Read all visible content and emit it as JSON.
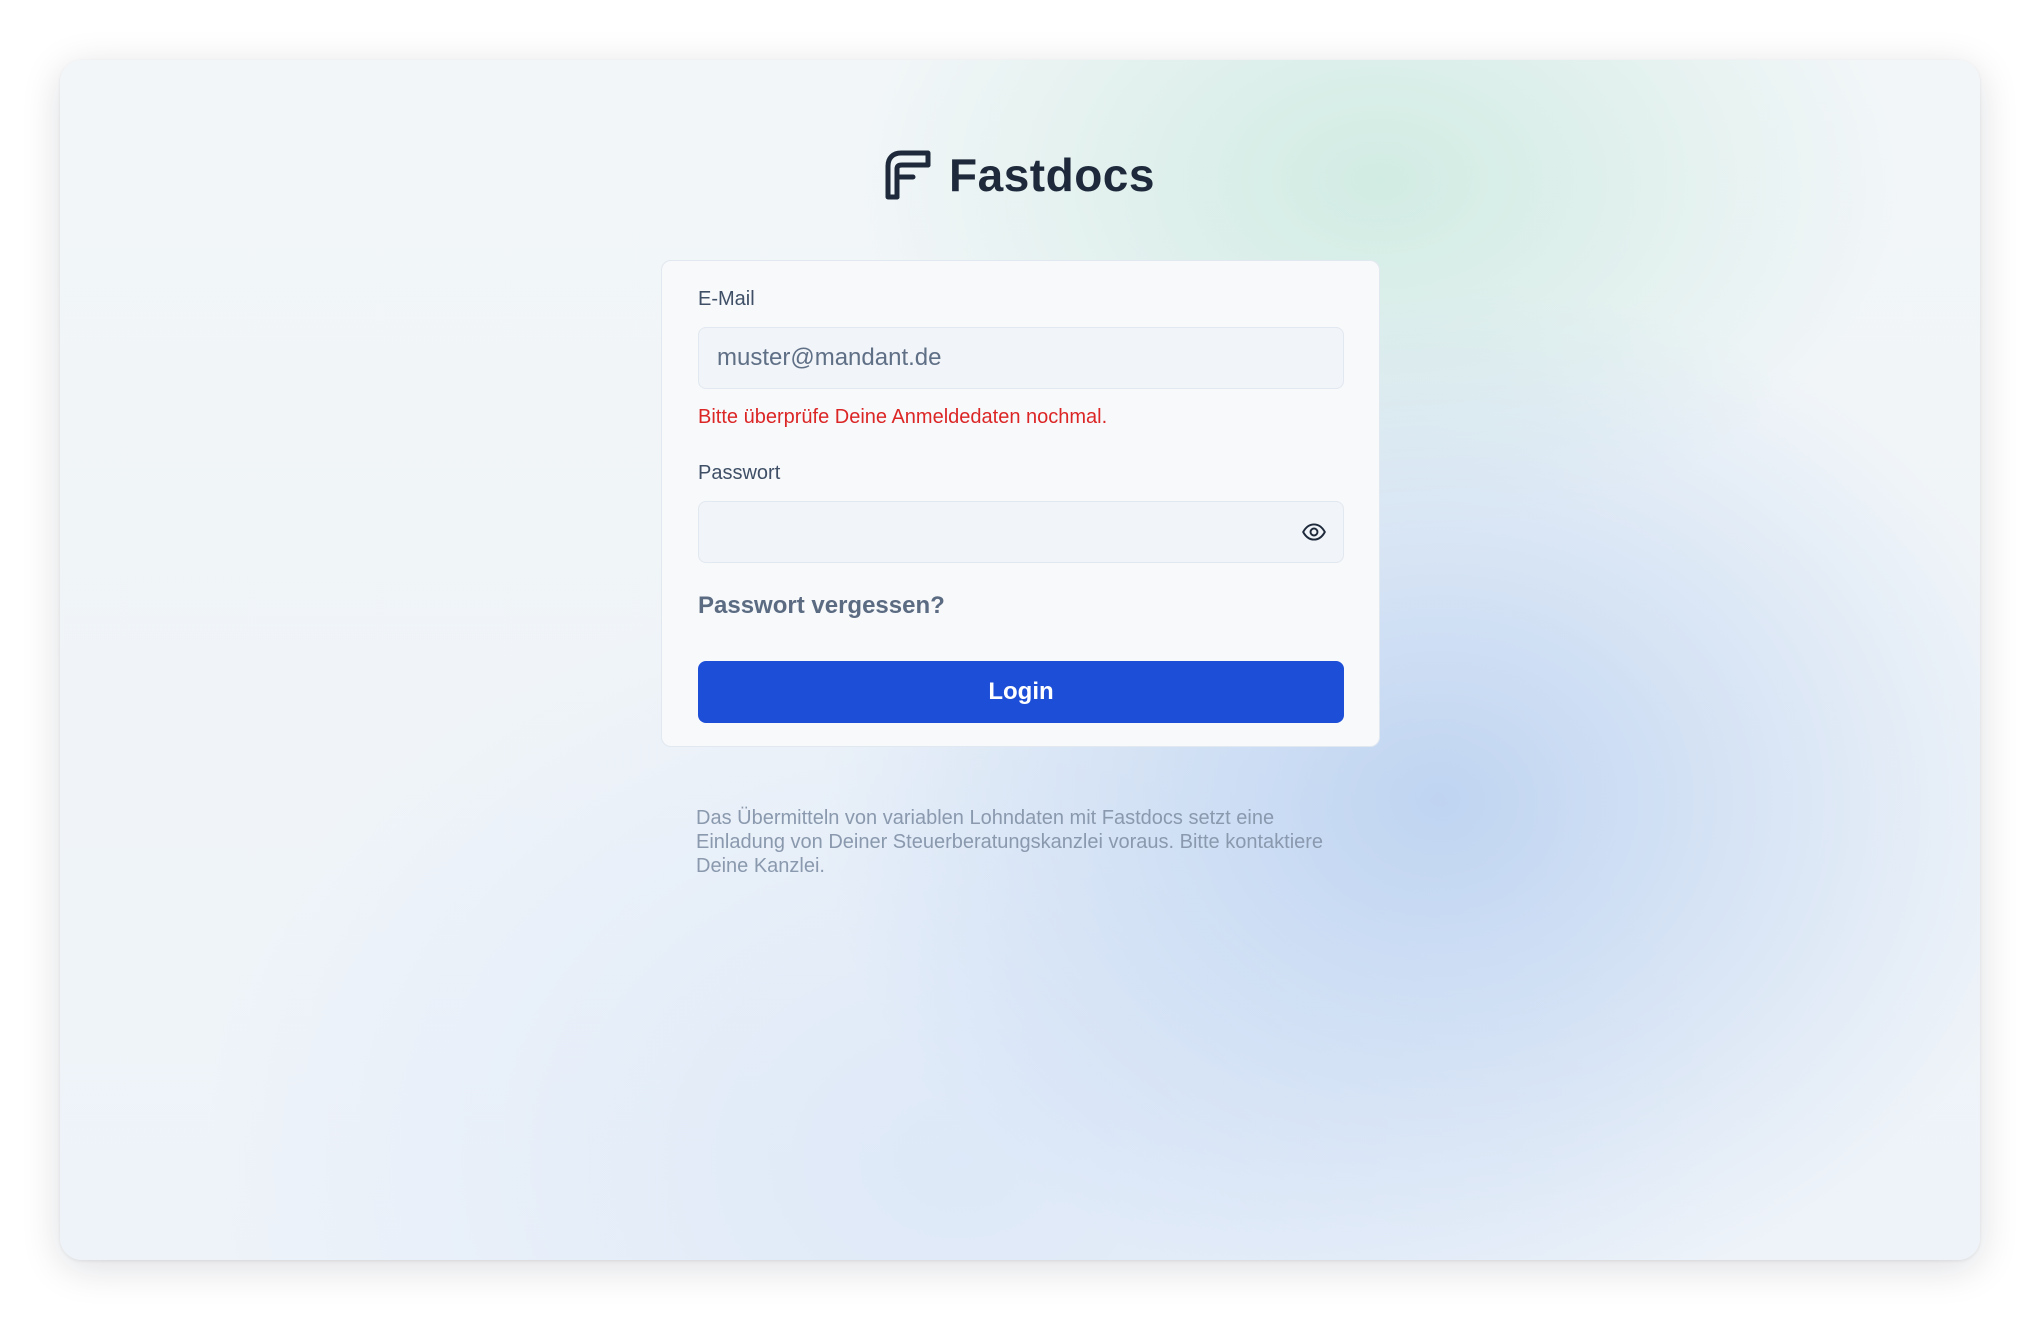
{
  "brand": {
    "name": "Fastdocs",
    "color": "#1e2a3b"
  },
  "form": {
    "email_label": "E-Mail",
    "email_value": "muster@mandant.de",
    "error_message": "Bitte überprüfe Deine Anmeldedaten nochmal.",
    "password_label": "Passwort",
    "password_value": "",
    "show_password_icon": "eye-icon",
    "forgot_link": "Passwort vergessen?",
    "login_button": "Login"
  },
  "footer": {
    "note": "Das Übermitteln von variablen Lohndaten mit Fastdocs setzt eine Einladung von Deiner Steuerberatungskanzlei voraus. Bitte kontaktiere Deine Kanzlei."
  },
  "colors": {
    "accent": "#1d4ed8",
    "error": "#dc2626"
  }
}
